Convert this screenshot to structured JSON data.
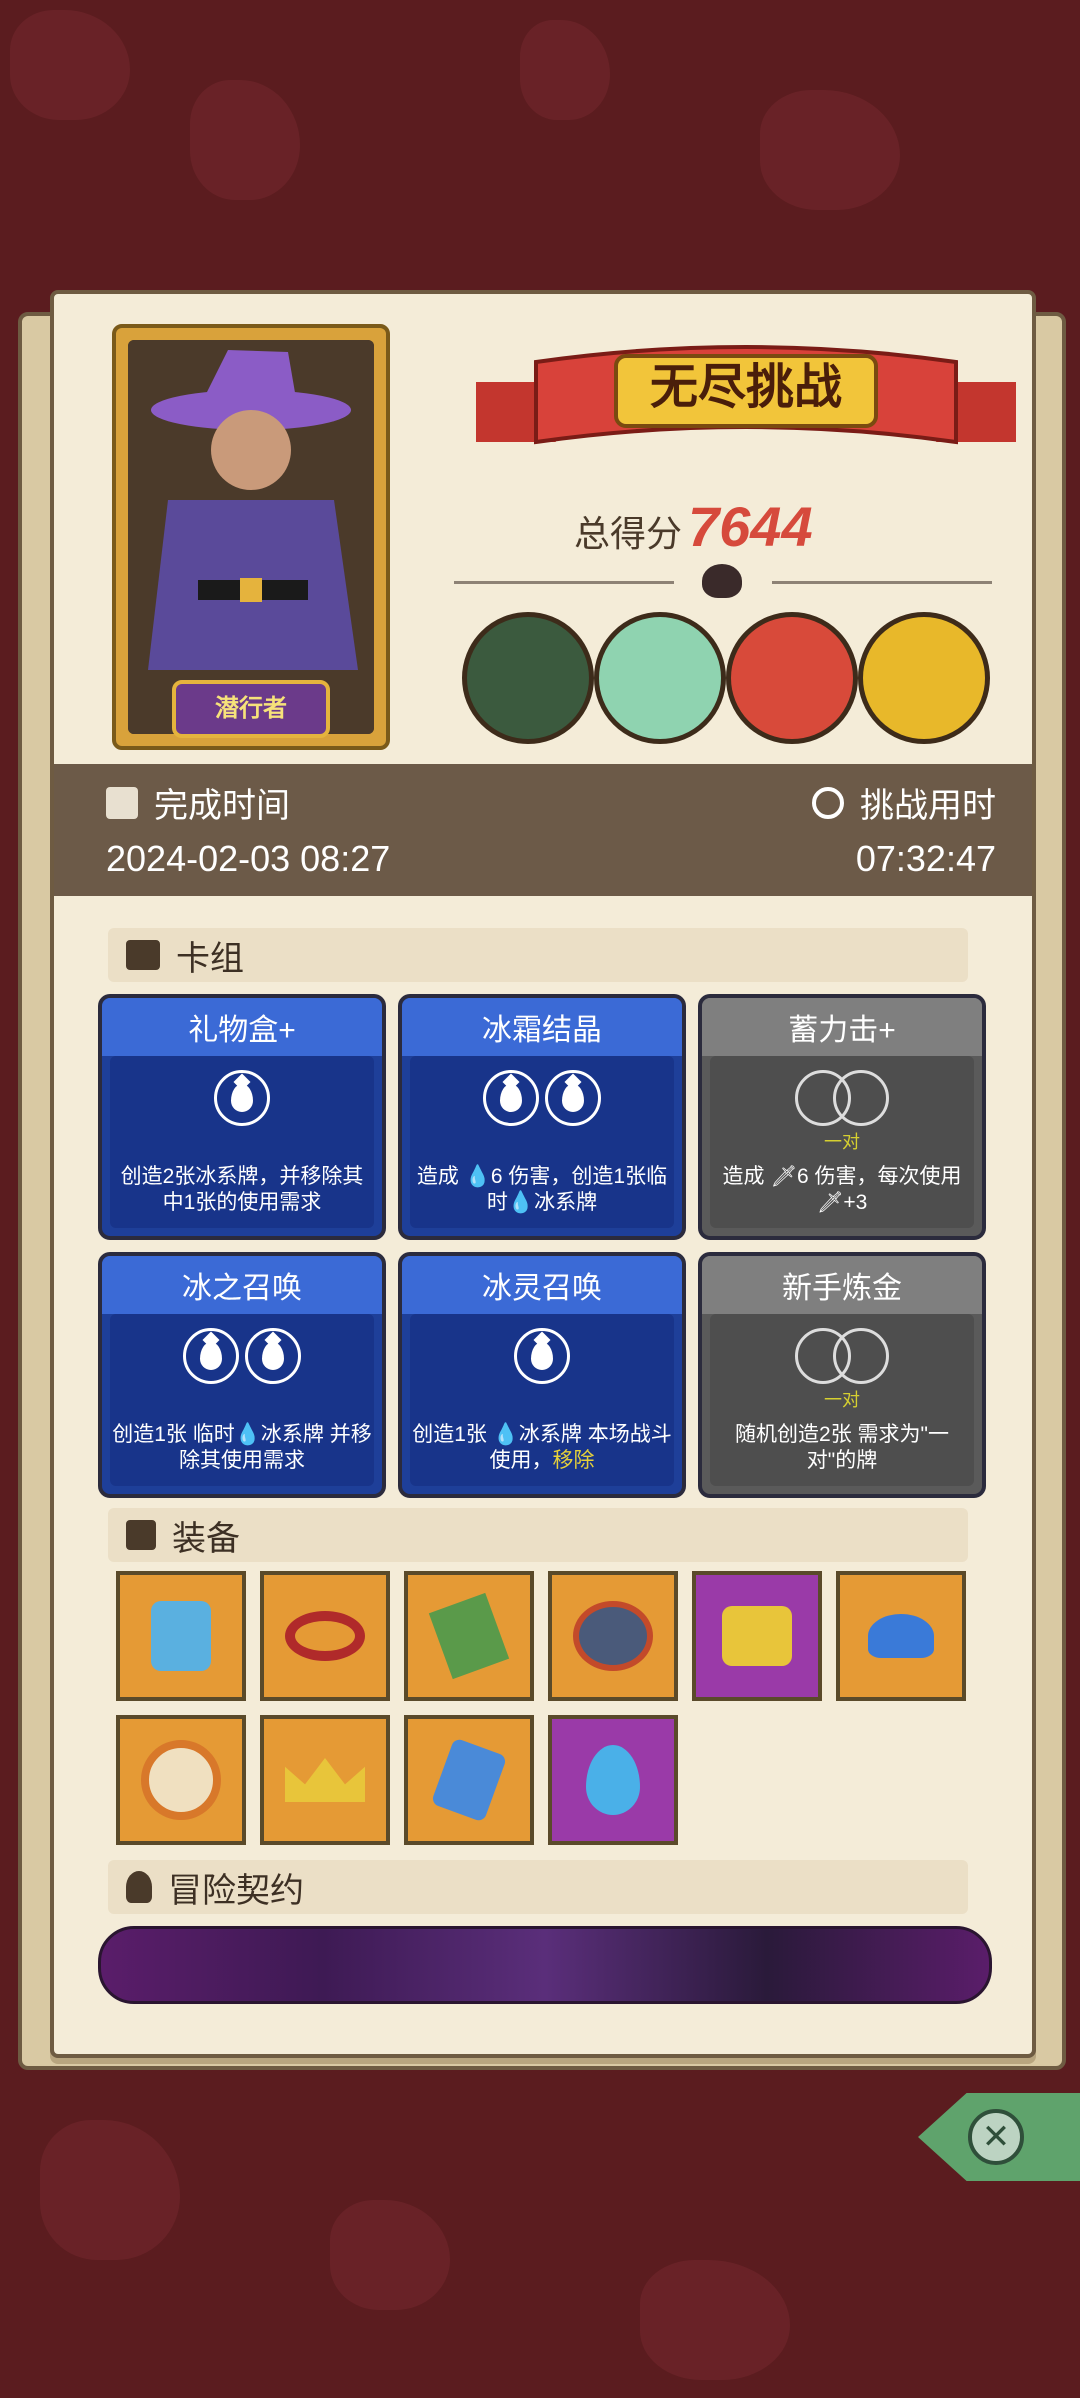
{
  "portrait": {
    "character_name": "潜行者"
  },
  "banner": {
    "title": "无尽挑战"
  },
  "score": {
    "label": "总得分",
    "value": "7644"
  },
  "bosses": [
    "green-helmet-boss",
    "lizard-boss",
    "skull-boss",
    "sunflower-boss"
  ],
  "info": {
    "complete_time_label": "完成时间",
    "complete_time_value": "2024-02-03 08:27",
    "challenge_time_label": "挑战用时",
    "challenge_time_value": "07:32:47"
  },
  "sections": {
    "deck": "卡组",
    "equipment": "装备",
    "contract": "冒险契约"
  },
  "cards": [
    {
      "name": "礼物盒+",
      "color": "blue",
      "cost": "ice1",
      "desc": "创造2张冰系牌，并移除其中1张的使用需求"
    },
    {
      "name": "冰霜结晶",
      "color": "blue",
      "cost": "ice2",
      "desc": "造成 💧6 伤害，创造1张临时💧冰系牌"
    },
    {
      "name": "蓄力击+",
      "color": "gray",
      "cost": "pair",
      "pair": "一对",
      "desc": "造成 🗡6 伤害，每次使用🗡+3"
    },
    {
      "name": "冰之召唤",
      "color": "blue",
      "cost": "ice2",
      "desc": "创造1张 临时💧冰系牌 并移除其使用需求"
    },
    {
      "name": "冰灵召唤",
      "color": "blue",
      "cost": "ice1",
      "desc": "创造1张 💧冰系牌 本场战斗使用，",
      "desc_highlight": "移除"
    },
    {
      "name": "新手炼金",
      "color": "gray",
      "cost": "pair",
      "pair": "一对",
      "desc": "随机创造2张 需求为\"一对\"的牌"
    }
  ],
  "equipment": [
    {
      "icon": "ice-shield-icon",
      "bg": "orange"
    },
    {
      "icon": "spiked-collar-icon",
      "bg": "orange"
    },
    {
      "icon": "moss-book-icon",
      "bg": "orange"
    },
    {
      "icon": "lava-bowl-icon",
      "bg": "orange"
    },
    {
      "icon": "golden-dice-icon",
      "bg": "purple"
    },
    {
      "icon": "blue-mushroom-icon",
      "bg": "orange"
    },
    {
      "icon": "eye-coin-icon",
      "bg": "orange"
    },
    {
      "icon": "golden-crown-icon",
      "bg": "orange"
    },
    {
      "icon": "ice-bottle-icon",
      "bg": "orange"
    },
    {
      "icon": "water-drop-icon",
      "bg": "purple"
    }
  ]
}
